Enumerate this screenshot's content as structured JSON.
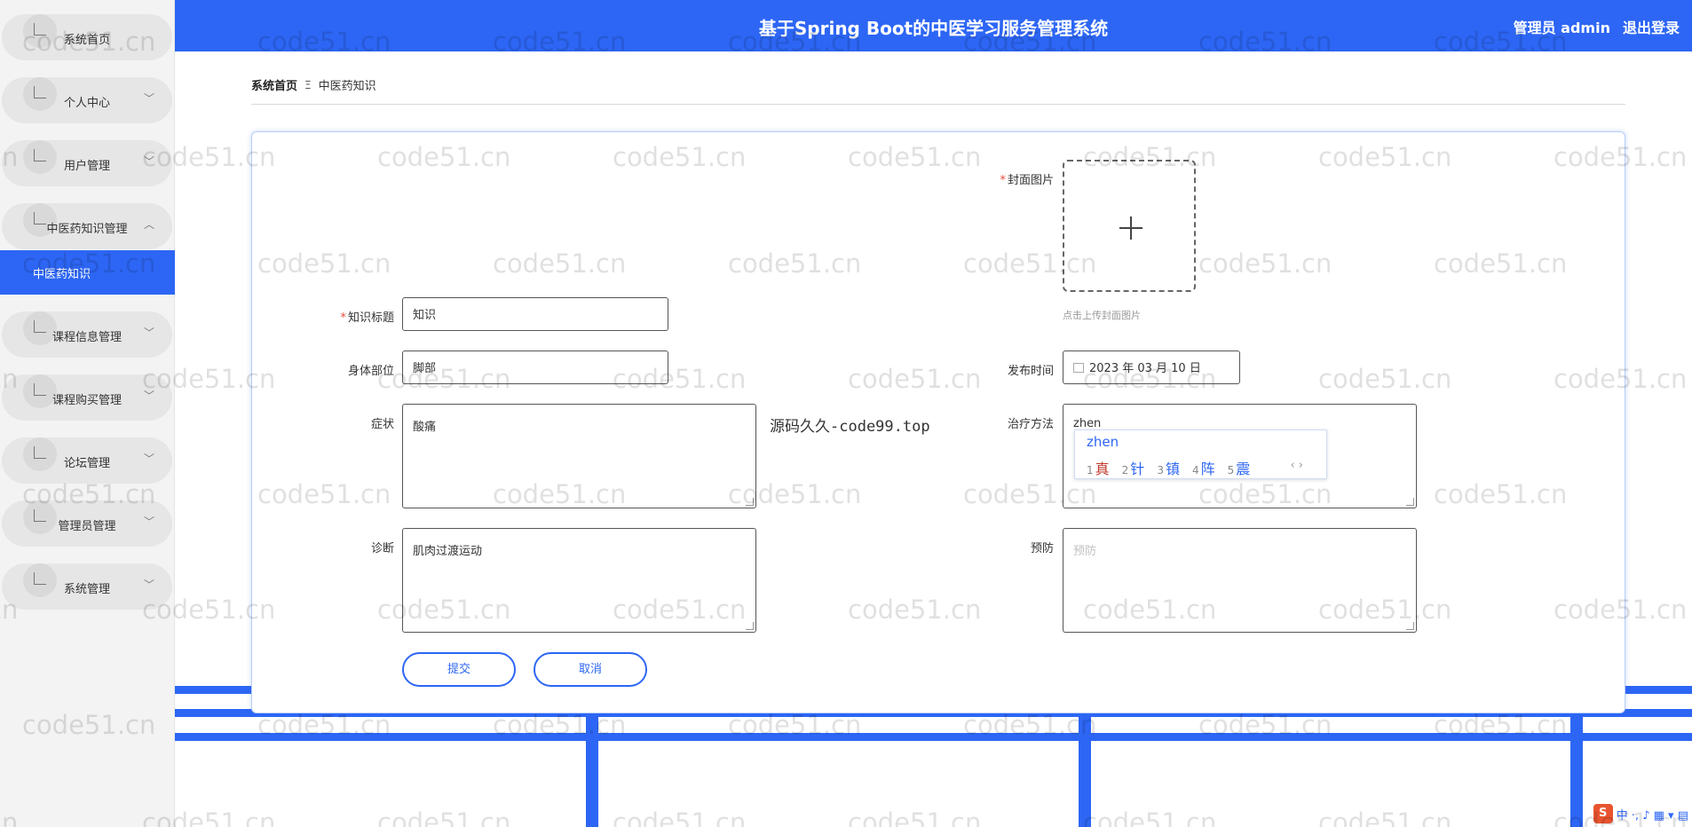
{
  "header": {
    "title": "基于Spring Boot的中医学习服务管理系统",
    "user": "管理员 admin",
    "logout": "退出登录"
  },
  "sidebar": {
    "items": [
      {
        "label": "系统首页",
        "arrow": ""
      },
      {
        "label": "个人中心",
        "arrow": "﹀"
      },
      {
        "label": "用户管理",
        "arrow": "﹀"
      },
      {
        "label": "中医药知识管理",
        "arrow": "︿"
      },
      {
        "label": "课程信息管理",
        "arrow": "﹀"
      },
      {
        "label": "课程购买管理",
        "arrow": "﹀"
      },
      {
        "label": "论坛管理",
        "arrow": "﹀"
      },
      {
        "label": "管理员管理",
        "arrow": "﹀"
      },
      {
        "label": "系统管理",
        "arrow": "﹀"
      }
    ],
    "active_sub": "中医药知识"
  },
  "breadcrumb": {
    "home": "系统首页",
    "sep": "Ξ",
    "current": "中医药知识"
  },
  "form": {
    "cover_label": "封面图片",
    "cover_hint": "点击上传封面图片",
    "title_label": "知识标题",
    "title_value": "知识",
    "body_part_label": "身体部位",
    "body_part_value": "脚部",
    "publish_label": "发布时间",
    "publish_value": "2023 年 03 月 10 日",
    "symptom_label": "症状",
    "symptom_value": "酸痛",
    "treatment_label": "治疗方法",
    "treatment_value": "zhen",
    "diagnosis_label": "诊断",
    "diagnosis_value": "肌肉过渡运动",
    "prevention_label": "预防",
    "prevention_placeholder": "预防",
    "submit": "提交",
    "cancel": "取消"
  },
  "note": "源码久久-code99.top",
  "ime": {
    "input": "zhen",
    "candidates": [
      {
        "n": "1",
        "c": "真"
      },
      {
        "n": "2",
        "c": "针"
      },
      {
        "n": "3",
        "c": "镇"
      },
      {
        "n": "4",
        "c": "阵"
      },
      {
        "n": "5",
        "c": "震"
      }
    ],
    "nav": "‹ ›",
    "bar_logo": "S",
    "bar_text": "中 ·, ♪ ▦ ▾ ▤"
  },
  "watermark": "code51.cn",
  "colors": {
    "brand": "#2d66f4",
    "required": "#e74c3c"
  }
}
